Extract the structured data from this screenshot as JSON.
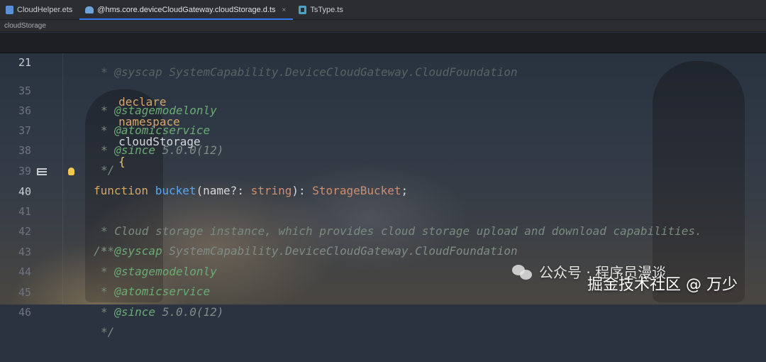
{
  "tabs": [
    {
      "label": "CloudHelper.ets",
      "icon": "ets-file-icon",
      "active": false
    },
    {
      "label": "@hms.core.deviceCloudGateway.cloudStorage.d.ts",
      "icon": "cloud-file-icon",
      "active": true,
      "close": "×"
    },
    {
      "label": "TsType.ts",
      "icon": "ts-file-icon",
      "active": false
    }
  ],
  "breadcrumb": "cloudStorage",
  "sticky": {
    "line": "21",
    "declare": "declare",
    "namespace": "namespace",
    "name": "cloudStorage",
    "brace": "{"
  },
  "peek_line": "* @syscap SystemCapability.DeviceCloudGateway.CloudFoundation",
  "lines": [
    {
      "num": "35",
      "tag": "@stagemodelonly",
      "text": ""
    },
    {
      "num": "36",
      "tag": "@atomicservice",
      "text": ""
    },
    {
      "num": "37",
      "tag": "@since",
      "text": "5.0.0(12)"
    },
    {
      "num": "38",
      "end": "*/"
    },
    {
      "num": "39",
      "kw": "function",
      "fn": "bucket",
      "p1": "(",
      "param": "name?",
      "colon": ": ",
      "ptype": "string",
      "p2": "): ",
      "rtype": "StorageBucket",
      "semi": ";"
    },
    {
      "num": "40",
      "open": "/**"
    },
    {
      "num": "41",
      "desc": "Cloud storage instance, which provides cloud storage upload and download capabilities."
    },
    {
      "num": "42",
      "tag": "@syscap",
      "text": "SystemCapability.DeviceCloudGateway.CloudFoundation"
    },
    {
      "num": "43",
      "tag": "@stagemodelonly",
      "text": ""
    },
    {
      "num": "44",
      "tag": "@atomicservice",
      "text": ""
    },
    {
      "num": "45",
      "tag": "@since",
      "text": "5.0.0(12)"
    },
    {
      "num": "46",
      "end": "*/"
    }
  ],
  "watermark": {
    "wechat": "公众号 · 程序员漫谈",
    "juejin": "掘金技术社区 @ 万少"
  }
}
